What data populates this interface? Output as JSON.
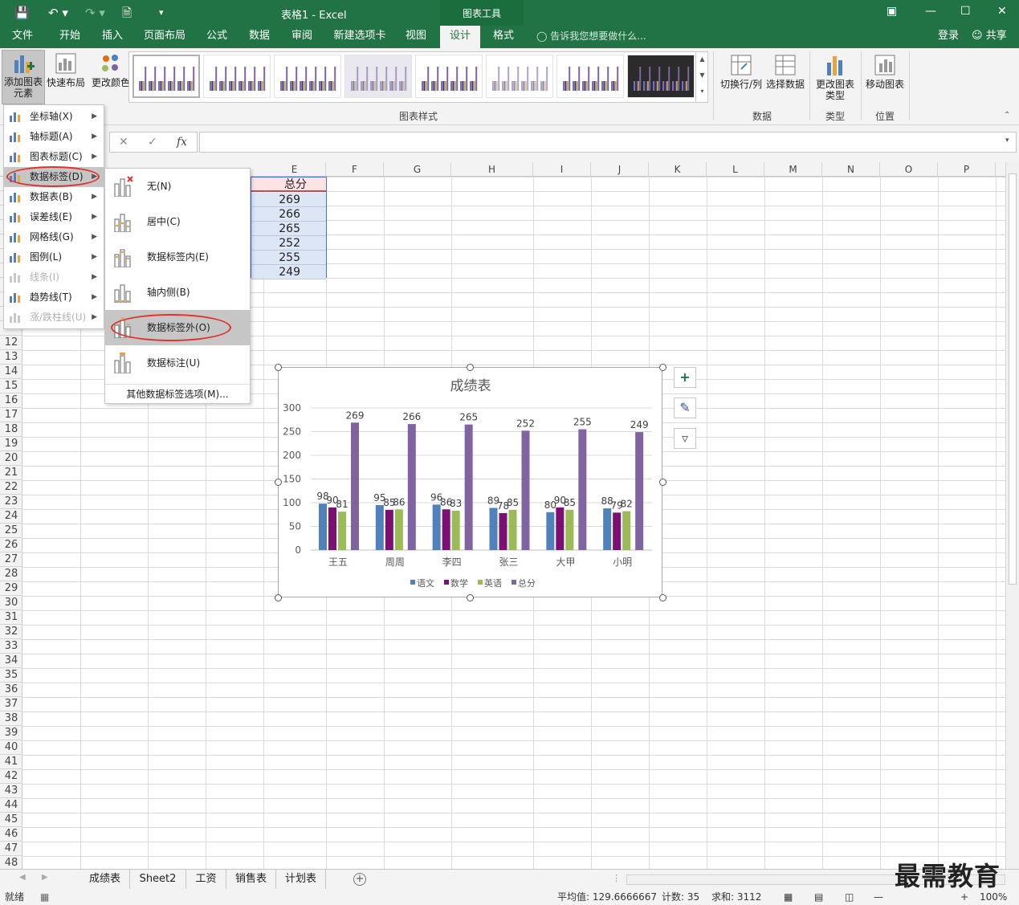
{
  "titlebar": {
    "title": "表格1 - Excel",
    "chart_tools": "图表工具"
  },
  "tabs": [
    {
      "label": "文件"
    },
    {
      "label": "开始"
    },
    {
      "label": "插入"
    },
    {
      "label": "页面布局"
    },
    {
      "label": "公式"
    },
    {
      "label": "数据"
    },
    {
      "label": "审阅"
    },
    {
      "label": "新建选项卡"
    },
    {
      "label": "视图"
    },
    {
      "label": "设计"
    },
    {
      "label": "格式"
    }
  ],
  "active_tab": "设计",
  "tell_me": "告诉我您想要做什么...",
  "login": "登录",
  "share": "共享",
  "ribbon": {
    "add_element": "添加图表元素",
    "quick_layout": "快速布局",
    "change_color": "更改颜色",
    "styles_group": "图表样式",
    "switch_rowcol": "切换行/列",
    "select_data": "选择数据",
    "data_group": "数据",
    "change_type": "更改图表类型",
    "type_group": "类型",
    "move_chart": "移动图表",
    "location_group": "位置"
  },
  "formula_bar": {
    "cancel": "✕",
    "confirm": "✓",
    "fx": "fx",
    "value": ""
  },
  "columns": [
    "E",
    "F",
    "G",
    "H",
    "I",
    "J",
    "K",
    "L",
    "M",
    "N",
    "O",
    "P"
  ],
  "rows": [
    "12",
    "13",
    "14",
    "15",
    "16",
    "17",
    "18",
    "19",
    "20",
    "21",
    "22",
    "23",
    "24",
    "25",
    "26",
    "27",
    "28",
    "29",
    "30",
    "31",
    "32",
    "33",
    "34",
    "35",
    "36",
    "37",
    "38",
    "39",
    "40",
    "41",
    "42",
    "43",
    "44",
    "45",
    "46",
    "47",
    "48"
  ],
  "total_column": {
    "header": "总分",
    "values": [
      "269",
      "266",
      "265",
      "252",
      "255",
      "249"
    ]
  },
  "menu1": {
    "items": [
      {
        "label": "坐标轴(X)",
        "disabled": false
      },
      {
        "label": "轴标题(A)",
        "disabled": false
      },
      {
        "label": "图表标题(C)",
        "disabled": false
      },
      {
        "label": "数据标签(D)",
        "disabled": false
      },
      {
        "label": "数据表(B)",
        "disabled": false
      },
      {
        "label": "误差线(E)",
        "disabled": false
      },
      {
        "label": "网格线(G)",
        "disabled": false
      },
      {
        "label": "图例(L)",
        "disabled": false
      },
      {
        "label": "线条(I)",
        "disabled": true
      },
      {
        "label": "趋势线(T)",
        "disabled": false
      },
      {
        "label": "涨/跌柱线(U)",
        "disabled": true
      }
    ],
    "highlighted": 3
  },
  "menu2": {
    "items": [
      {
        "label": "无(N)"
      },
      {
        "label": "居中(C)"
      },
      {
        "label": "数据标签内(E)"
      },
      {
        "label": "轴内侧(B)"
      },
      {
        "label": "数据标签外(O)"
      },
      {
        "label": "数据标注(U)"
      }
    ],
    "highlighted": 4,
    "more": "其他数据标签选项(M)..."
  },
  "sheets": [
    {
      "label": "成绩表"
    },
    {
      "label": "Sheet2"
    },
    {
      "label": "工资"
    },
    {
      "label": "销售表"
    },
    {
      "label": "计划表"
    }
  ],
  "active_sheet": 0,
  "statusbar": {
    "ready": "就绪",
    "average": "平均值: 129.6666667",
    "count": "计数: 35",
    "sum": "求和: 3112",
    "zoom": "100%"
  },
  "watermark": "最需教育",
  "colors": {
    "excel_green": "#217346",
    "series_chinese": "#4f81bd",
    "series_math": "#7b0f72",
    "series_english": "#9bbb59",
    "series_total": "#8064a2",
    "highlight_ellipse": "#e0322c"
  },
  "chart_data": {
    "type": "bar",
    "title": "成绩表",
    "categories": [
      "王五",
      "周周",
      "李四",
      "张三",
      "大甲",
      "小明"
    ],
    "series": [
      {
        "name": "语文",
        "values": [
          98,
          95,
          96,
          89,
          80,
          88
        ]
      },
      {
        "name": "数学",
        "values": [
          90,
          85,
          86,
          78,
          90,
          79
        ]
      },
      {
        "name": "英语",
        "values": [
          81,
          86,
          83,
          85,
          85,
          82
        ]
      },
      {
        "name": "总分",
        "values": [
          269,
          266,
          265,
          252,
          255,
          249
        ]
      }
    ],
    "ylim": [
      0,
      300
    ],
    "yticks": [
      0,
      50,
      100,
      150,
      200,
      250,
      300
    ],
    "legend": "bottom",
    "grid": true,
    "data_labels": "outside-end"
  }
}
